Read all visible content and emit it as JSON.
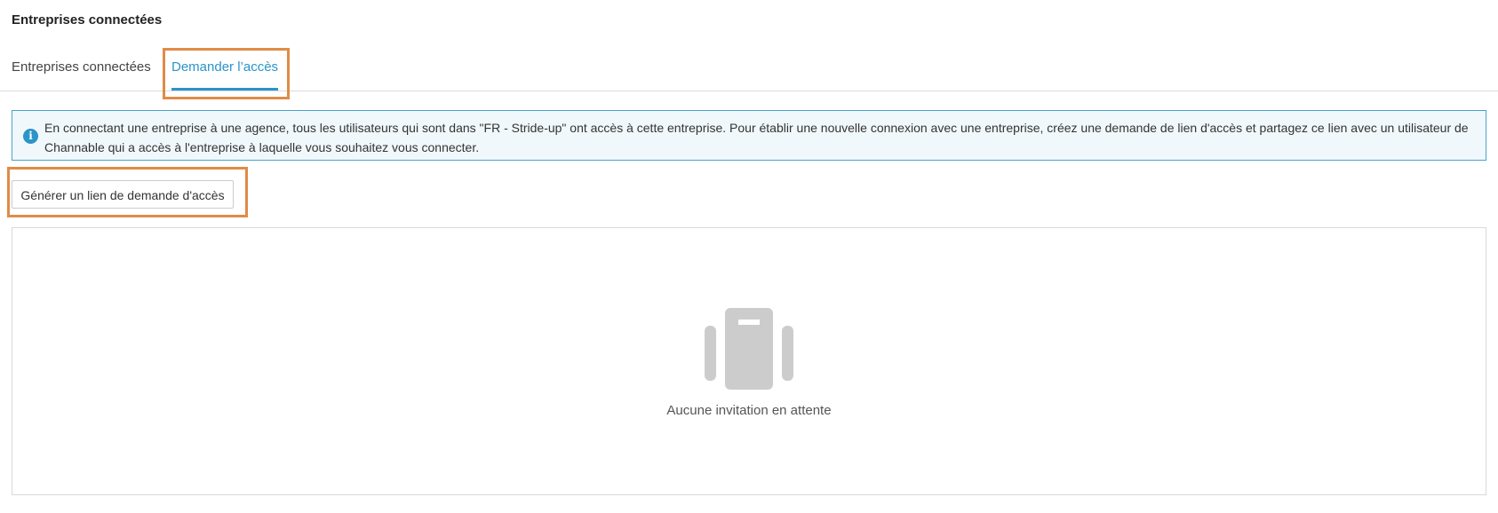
{
  "page": {
    "title": "Entreprises connectées"
  },
  "tabs": [
    {
      "label": "Entreprises connectées",
      "active": false
    },
    {
      "label": "Demander l’accès",
      "active": true
    }
  ],
  "info": {
    "icon": "info-icon",
    "text": "En connectant une entreprise à une agence, tous les utilisateurs qui sont dans \"FR - Stride-up\" ont accès à cette entreprise. Pour établir une nouvelle connexion avec une entreprise, créez une demande de lien d'accès et partagez ce lien avec un utilisateur de Channable qui a accès à l'entreprise à laquelle vous souhaitez vous connecter."
  },
  "actions": {
    "generate_label": "Générer un lien de demande d'accès"
  },
  "empty_state": {
    "icon": "briefcase-icon",
    "text": "Aucune invitation en attente"
  },
  "colors": {
    "accent": "#2b94c9",
    "highlight": "#e08b47",
    "info_bg": "#f1f8fb",
    "icon_gray": "#cccccc"
  }
}
